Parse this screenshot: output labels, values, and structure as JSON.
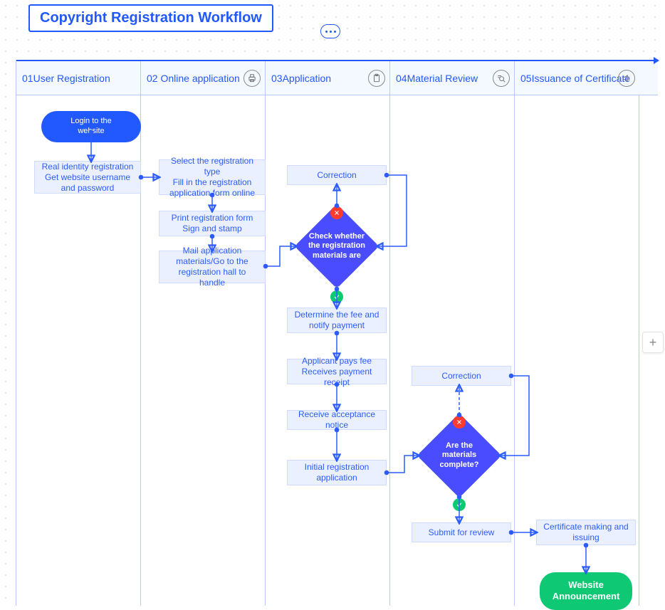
{
  "title": "Copyright Registration Workflow",
  "lanes": [
    {
      "num": "01",
      "label": "User Registration"
    },
    {
      "num": "02",
      "label": "Online application"
    },
    {
      "num": "03",
      "label": "Application"
    },
    {
      "num": "04",
      "label": "Material Review"
    },
    {
      "num": "05",
      "label": "Issuance of Certificate"
    }
  ],
  "nodes": {
    "login": "Login to the website",
    "identity": "Real identity registration\nGet website username and password",
    "select_type": "Select the registration type\nFill in the registration application form online",
    "print": "Print registration form\nSign and stamp",
    "mail": "Mail application materials/Go to the registration hall to handle",
    "correction1": "Correction",
    "check": "Check whether the registration materials are",
    "determine_fee": "Determine the fee and notify payment",
    "pay": "Applicant pays fee\nReceives payment receipt",
    "accept_notice": "Receive acceptance notice",
    "initial_reg": "Initial registration application",
    "correction2": "Correction",
    "complete": "Are the materials complete?",
    "submit_review": "Submit for review",
    "cert_issuing": "Certificate making and issuing",
    "announce": "Website Announcement"
  }
}
